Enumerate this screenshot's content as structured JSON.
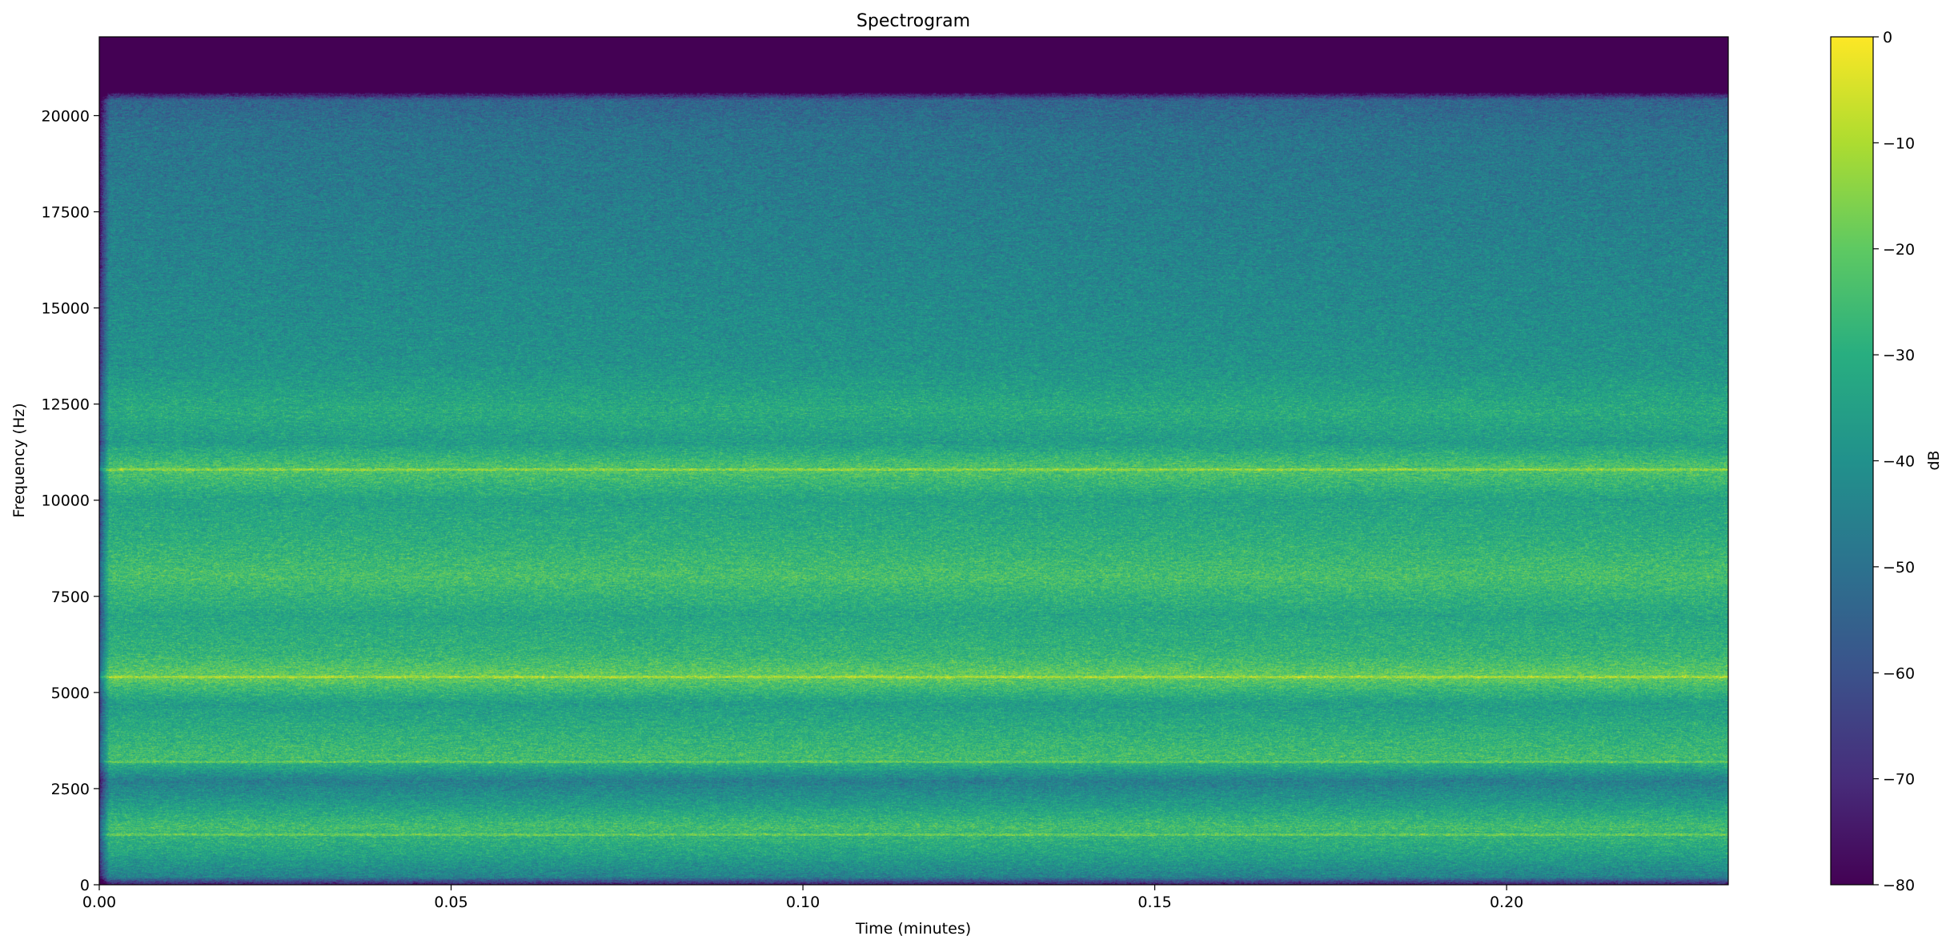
{
  "chart_data": {
    "type": "heatmap",
    "title": "Spectrogram",
    "xlabel": "Time (minutes)",
    "ylabel": "Frequency (Hz)",
    "xlim": [
      0,
      0.2315
    ],
    "ylim": [
      0,
      22050
    ],
    "x_ticks": [
      0.0,
      0.05,
      0.1,
      0.15,
      0.2
    ],
    "x_tick_labels": [
      "0.00",
      "0.05",
      "0.10",
      "0.15",
      "0.20"
    ],
    "y_ticks": [
      0,
      2500,
      5000,
      7500,
      10000,
      12500,
      15000,
      17500,
      20000
    ],
    "y_tick_labels": [
      "0",
      "2500",
      "5000",
      "7500",
      "10000",
      "12500",
      "15000",
      "17500",
      "20000"
    ],
    "grid": false,
    "colormap": "viridis",
    "colorbar": {
      "label": "dB",
      "range": [
        -80,
        0
      ],
      "ticks": [
        0,
        -10,
        -20,
        -30,
        -40,
        -50,
        -60,
        -70,
        -80
      ],
      "tick_labels": [
        "0",
        "−10",
        "−20",
        "−30",
        "−40",
        "−50",
        "−60",
        "−70",
        "−80"
      ]
    },
    "spectral_profile": {
      "description_level_dB_by_frequency": [
        {
          "hz": 0,
          "db": -75
        },
        {
          "hz": 200,
          "db": -45
        },
        {
          "hz": 800,
          "db": -34
        },
        {
          "hz": 1500,
          "db": -25
        },
        {
          "hz": 2200,
          "db": -38
        },
        {
          "hz": 2700,
          "db": -46
        },
        {
          "hz": 3300,
          "db": -25
        },
        {
          "hz": 4000,
          "db": -30
        },
        {
          "hz": 4700,
          "db": -36
        },
        {
          "hz": 5400,
          "db": -19
        },
        {
          "hz": 6000,
          "db": -28
        },
        {
          "hz": 7000,
          "db": -33
        },
        {
          "hz": 8000,
          "db": -24
        },
        {
          "hz": 9000,
          "db": -30
        },
        {
          "hz": 10000,
          "db": -34
        },
        {
          "hz": 10800,
          "db": -22
        },
        {
          "hz": 11500,
          "db": -36
        },
        {
          "hz": 12300,
          "db": -31
        },
        {
          "hz": 13500,
          "db": -39
        },
        {
          "hz": 15000,
          "db": -42
        },
        {
          "hz": 17500,
          "db": -46
        },
        {
          "hz": 19500,
          "db": -49
        },
        {
          "hz": 20400,
          "db": -54
        },
        {
          "hz": 20600,
          "db": -80
        },
        {
          "hz": 22050,
          "db": -80
        }
      ],
      "tonal_lines_hz": [
        1300,
        3200,
        5400,
        10800
      ]
    }
  }
}
